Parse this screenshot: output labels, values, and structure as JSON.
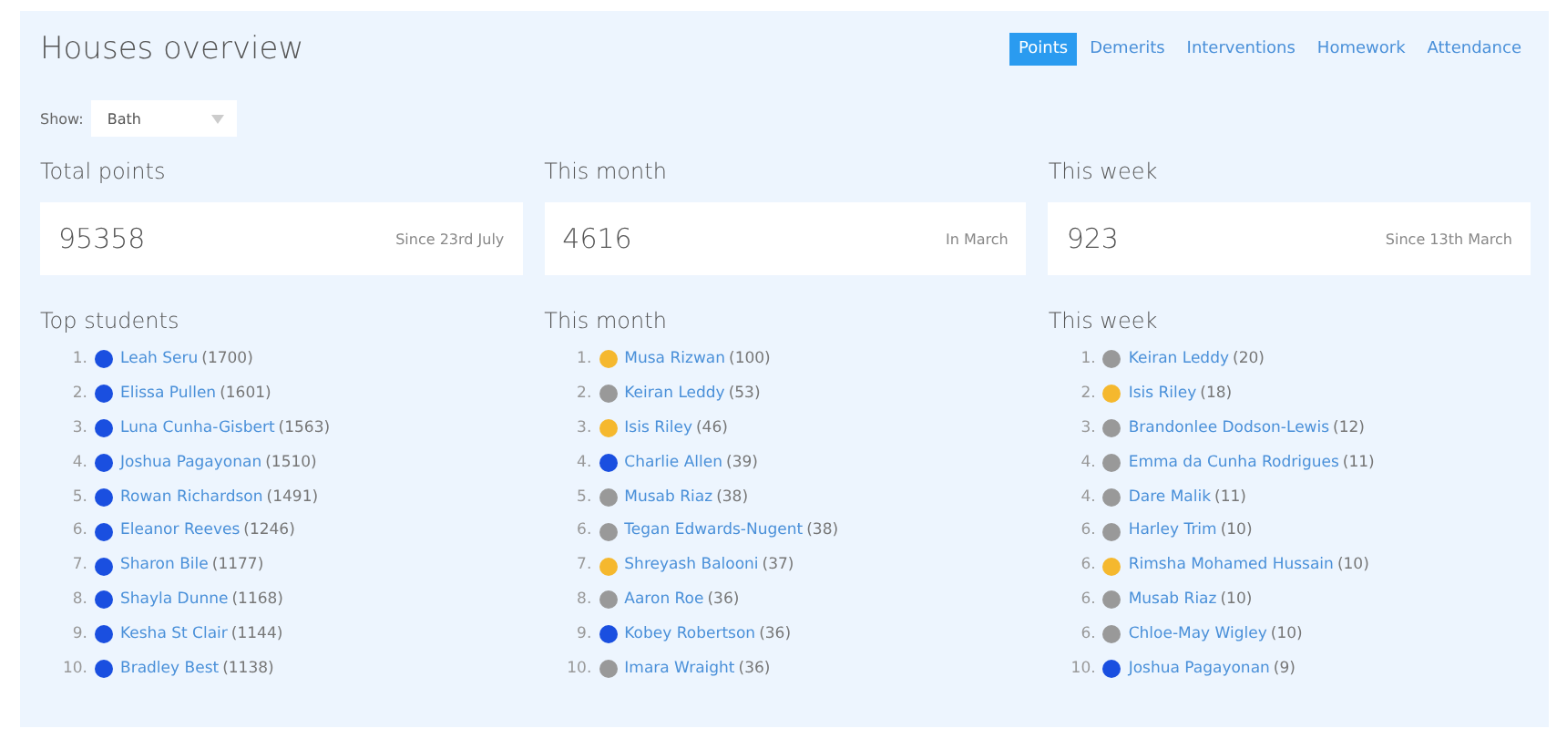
{
  "title": "Houses overview",
  "tabs": [
    {
      "label": "Points",
      "selected": true
    },
    {
      "label": "Demerits",
      "selected": false
    },
    {
      "label": "Interventions",
      "selected": false
    },
    {
      "label": "Homework",
      "selected": false
    },
    {
      "label": "Attendance",
      "selected": false
    }
  ],
  "filter": {
    "label": "Show:",
    "value": "Bath"
  },
  "stats": [
    {
      "heading": "Total points",
      "value": "95358",
      "note": "Since 23rd July"
    },
    {
      "heading": "This month",
      "value": "4616",
      "note": "In March"
    },
    {
      "heading": "This week",
      "value": "923",
      "note": "Since 13th March"
    }
  ],
  "lists": [
    {
      "heading": "Top students",
      "items": [
        {
          "rank": "1.",
          "color": "#1a4fe0",
          "name": "Leah Seru",
          "score": "(1700)"
        },
        {
          "rank": "2.",
          "color": "#1a4fe0",
          "name": "Elissa Pullen",
          "score": "(1601)"
        },
        {
          "rank": "3.",
          "color": "#1a4fe0",
          "name": "Luna Cunha-Gisbert",
          "score": "(1563)"
        },
        {
          "rank": "4.",
          "color": "#1a4fe0",
          "name": "Joshua Pagayonan",
          "score": "(1510)"
        },
        {
          "rank": "5.",
          "color": "#1a4fe0",
          "name": "Rowan Richardson",
          "score": "(1491)"
        },
        {
          "rank": "6.",
          "color": "#1a4fe0",
          "name": "Eleanor Reeves",
          "score": "(1246)"
        },
        {
          "rank": "7.",
          "color": "#1a4fe0",
          "name": "Sharon Bile",
          "score": "(1177)"
        },
        {
          "rank": "8.",
          "color": "#1a4fe0",
          "name": "Shayla Dunne",
          "score": "(1168)"
        },
        {
          "rank": "9.",
          "color": "#1a4fe0",
          "name": "Kesha St Clair",
          "score": "(1144)"
        },
        {
          "rank": "10.",
          "color": "#1a4fe0",
          "name": "Bradley Best",
          "score": "(1138)"
        }
      ]
    },
    {
      "heading": "This month",
      "items": [
        {
          "rank": "1.",
          "color": "#f5b82e",
          "name": "Musa Rizwan",
          "score": "(100)"
        },
        {
          "rank": "2.",
          "color": "#999999",
          "name": "Keiran Leddy",
          "score": "(53)"
        },
        {
          "rank": "3.",
          "color": "#f5b82e",
          "name": "Isis Riley",
          "score": "(46)"
        },
        {
          "rank": "4.",
          "color": "#1a4fe0",
          "name": "Charlie Allen",
          "score": "(39)"
        },
        {
          "rank": "5.",
          "color": "#999999",
          "name": "Musab Riaz",
          "score": "(38)"
        },
        {
          "rank": "6.",
          "color": "#999999",
          "name": "Tegan Edwards-Nugent",
          "score": "(38)"
        },
        {
          "rank": "7.",
          "color": "#f5b82e",
          "name": "Shreyash Balooni",
          "score": "(37)"
        },
        {
          "rank": "8.",
          "color": "#999999",
          "name": "Aaron Roe",
          "score": "(36)"
        },
        {
          "rank": "9.",
          "color": "#1a4fe0",
          "name": "Kobey Robertson",
          "score": "(36)"
        },
        {
          "rank": "10.",
          "color": "#999999",
          "name": "Imara Wraight",
          "score": "(36)"
        }
      ]
    },
    {
      "heading": "This week",
      "items": [
        {
          "rank": "1.",
          "color": "#999999",
          "name": "Keiran Leddy",
          "score": "(20)"
        },
        {
          "rank": "2.",
          "color": "#f5b82e",
          "name": "Isis Riley",
          "score": "(18)"
        },
        {
          "rank": "3.",
          "color": "#999999",
          "name": "Brandonlee Dodson-Lewis",
          "score": "(12)"
        },
        {
          "rank": "4.",
          "color": "#999999",
          "name": "Emma da Cunha Rodrigues",
          "score": "(11)"
        },
        {
          "rank": "4.",
          "color": "#999999",
          "name": "Dare Malik",
          "score": "(11)"
        },
        {
          "rank": "6.",
          "color": "#999999",
          "name": "Harley Trim",
          "score": "(10)"
        },
        {
          "rank": "6.",
          "color": "#f5b82e",
          "name": "Rimsha Mohamed Hussain",
          "score": "(10)"
        },
        {
          "rank": "6.",
          "color": "#999999",
          "name": "Musab Riaz",
          "score": "(10)"
        },
        {
          "rank": "6.",
          "color": "#999999",
          "name": "Chloe-May Wigley",
          "score": "(10)"
        },
        {
          "rank": "10.",
          "color": "#1a4fe0",
          "name": "Joshua Pagayonan",
          "score": "(9)"
        }
      ]
    }
  ]
}
